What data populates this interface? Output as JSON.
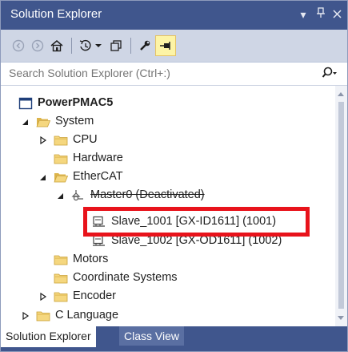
{
  "window": {
    "title": "Solution Explorer",
    "pin_glyph": "̄1",
    "close_glyph": "×",
    "menu_glyph": "▾"
  },
  "toolbar": {
    "icons": [
      "back-icon",
      "forward-icon",
      "home-icon",
      "history-icon",
      "dropdown-icon",
      "view-icon",
      "properties-icon",
      "pin-active-icon"
    ]
  },
  "search": {
    "placeholder": "Search Solution Explorer (Ctrl+:)"
  },
  "tree": {
    "items": [
      {
        "label": "PowerPMAC5",
        "icon": "project-icon"
      },
      {
        "label": "System",
        "icon": "folder-open-icon",
        "arrow": "expanded"
      },
      {
        "label": "CPU",
        "icon": "folder-icon",
        "arrow": "collapsed"
      },
      {
        "label": "Hardware",
        "icon": "folder-icon"
      },
      {
        "label": "EtherCAT",
        "icon": "folder-open-icon",
        "arrow": "expanded"
      },
      {
        "label": "Master0 (Deactivated)",
        "icon": "master-icon",
        "arrow": "expanded"
      },
      {
        "label": "Slave_1001 [GX-ID1611] (1001)",
        "icon": "slave-icon"
      },
      {
        "label": "Slave_1002 [GX-OD1611] (1002)",
        "icon": "slave-icon"
      },
      {
        "label": "Motors",
        "icon": "folder-icon"
      },
      {
        "label": "Coordinate Systems",
        "icon": "folder-icon"
      },
      {
        "label": "Encoder",
        "icon": "folder-icon",
        "arrow": "collapsed"
      },
      {
        "label": "C Language",
        "icon": "folder-icon",
        "arrow": "collapsed"
      }
    ]
  },
  "tabs": [
    {
      "label": "Solution Explorer",
      "active": true
    },
    {
      "label": "Class View",
      "active": false
    }
  ],
  "colors": {
    "accent": "#40568d",
    "highlight": "#e8131b",
    "folder": "#f5d77f"
  }
}
